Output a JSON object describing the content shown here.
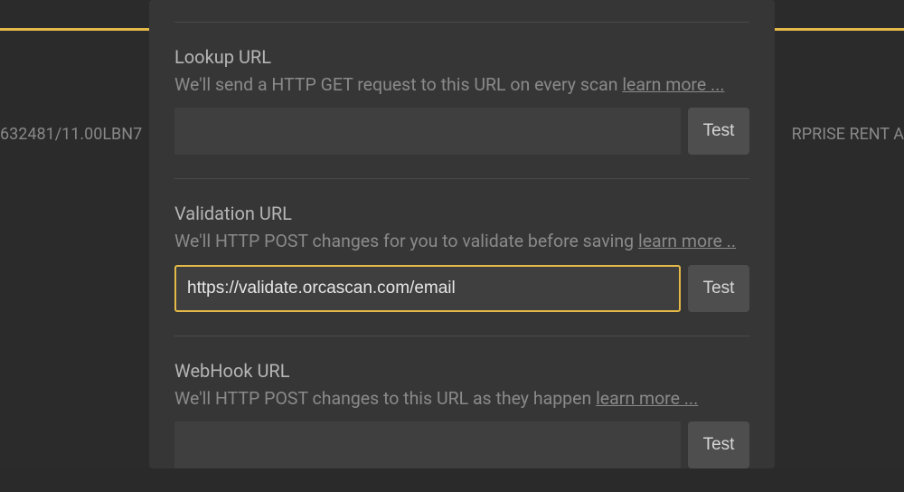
{
  "background": {
    "left_snippet": "632481/11.00LBN7",
    "right_snippet": "RPRISE RENT A"
  },
  "sections": {
    "lookup": {
      "title": "Lookup URL",
      "description": "We'll send a HTTP GET request to this URL on every scan ",
      "learn_more": "learn more ...",
      "value": "",
      "test_label": "Test"
    },
    "validation": {
      "title": "Validation URL",
      "description": "We'll HTTP POST changes for you to validate before saving ",
      "learn_more": "learn more ..",
      "value": "https://validate.orcascan.com/email",
      "test_label": "Test"
    },
    "webhook": {
      "title": "WebHook URL",
      "description": "We'll HTTP POST changes to this URL as they happen ",
      "learn_more": "learn more ...",
      "value": "",
      "test_label": "Test"
    }
  }
}
